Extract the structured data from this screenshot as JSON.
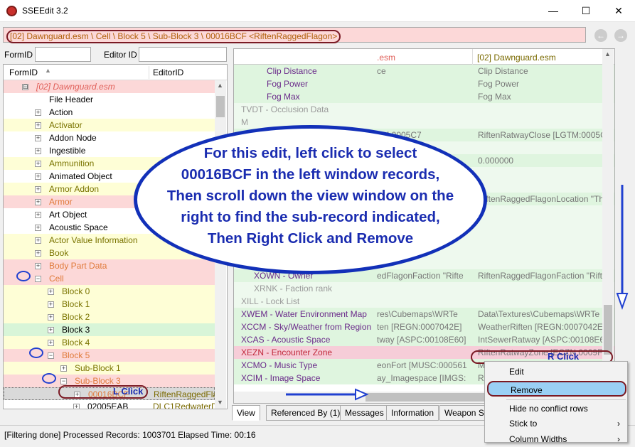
{
  "window": {
    "title": "SSEEdit 3.2",
    "minimize": "—",
    "maximize": "☐",
    "close": "✕"
  },
  "path": {
    "text": "[02] Dawnguard.esm \\ Cell \\ Block 5 \\ Sub-Block 3 \\ 00016BCF <RiftenRaggedFlagon>",
    "back_icon": "back-arrow-icon",
    "forward_icon": "forward-arrow-icon"
  },
  "filters": {
    "formid_label": "FormID",
    "formid_value": "",
    "editorid_label": "Editor ID",
    "editorid_value": ""
  },
  "tree": {
    "col_formid": "FormID",
    "col_editorid": "EditorID",
    "rows": [
      {
        "label": "[02] Dawnguard.esm",
        "editor": "",
        "indent": 0,
        "exp": "⊟",
        "bg": "red",
        "fg": "red",
        "italic": true
      },
      {
        "label": "File Header",
        "editor": "",
        "indent": 1,
        "exp": "",
        "bg": "white",
        "fg": "black"
      },
      {
        "label": "Action",
        "editor": "",
        "indent": 1,
        "exp": "+",
        "bg": "white",
        "fg": "black"
      },
      {
        "label": "Activator",
        "editor": "",
        "indent": 1,
        "exp": "+",
        "bg": "yellow",
        "fg": "olive"
      },
      {
        "label": "Addon Node",
        "editor": "",
        "indent": 1,
        "exp": "+",
        "bg": "white",
        "fg": "black"
      },
      {
        "label": "Ingestible",
        "editor": "",
        "indent": 1,
        "exp": "+",
        "bg": "white",
        "fg": "black"
      },
      {
        "label": "Ammunition",
        "editor": "",
        "indent": 1,
        "exp": "+",
        "bg": "yellow",
        "fg": "olive"
      },
      {
        "label": "Animated Object",
        "editor": "",
        "indent": 1,
        "exp": "+",
        "bg": "white",
        "fg": "black"
      },
      {
        "label": "Armor Addon",
        "editor": "",
        "indent": 1,
        "exp": "+",
        "bg": "yellow",
        "fg": "olive"
      },
      {
        "label": "Armor",
        "editor": "",
        "indent": 1,
        "exp": "+",
        "bg": "red",
        "fg": "orange"
      },
      {
        "label": "Art Object",
        "editor": "",
        "indent": 1,
        "exp": "+",
        "bg": "white",
        "fg": "black"
      },
      {
        "label": "Acoustic Space",
        "editor": "",
        "indent": 1,
        "exp": "+",
        "bg": "white",
        "fg": "black"
      },
      {
        "label": "Actor Value Information",
        "editor": "",
        "indent": 1,
        "exp": "+",
        "bg": "yellow",
        "fg": "olive"
      },
      {
        "label": "Book",
        "editor": "",
        "indent": 1,
        "exp": "+",
        "bg": "yellow",
        "fg": "olive"
      },
      {
        "label": "Body Part Data",
        "editor": "",
        "indent": 1,
        "exp": "+",
        "bg": "red",
        "fg": "orange"
      },
      {
        "label": "Cell",
        "editor": "",
        "indent": 1,
        "exp": "−",
        "bg": "red",
        "fg": "orange"
      },
      {
        "label": "Block 0",
        "editor": "",
        "indent": 2,
        "exp": "+",
        "bg": "yellow",
        "fg": "olive"
      },
      {
        "label": "Block 1",
        "editor": "",
        "indent": 2,
        "exp": "+",
        "bg": "yellow",
        "fg": "olive"
      },
      {
        "label": "Block 2",
        "editor": "",
        "indent": 2,
        "exp": "+",
        "bg": "yellow",
        "fg": "olive"
      },
      {
        "label": "Block 3",
        "editor": "",
        "indent": 2,
        "exp": "+",
        "bg": "green",
        "fg": "black"
      },
      {
        "label": "Block 4",
        "editor": "",
        "indent": 2,
        "exp": "+",
        "bg": "yellow",
        "fg": "olive"
      },
      {
        "label": "Block 5",
        "editor": "",
        "indent": 2,
        "exp": "−",
        "bg": "red",
        "fg": "orange"
      },
      {
        "label": "Sub-Block 1",
        "editor": "",
        "indent": 3,
        "exp": "+",
        "bg": "yellow",
        "fg": "olive"
      },
      {
        "label": "Sub-Block 3",
        "editor": "",
        "indent": 3,
        "exp": "−",
        "bg": "red",
        "fg": "orange"
      },
      {
        "label": "00016BCF",
        "editor": "RiftenRaggedFla",
        "indent": 4,
        "exp": "+",
        "bg": "sel",
        "fg": "orange"
      },
      {
        "label": "02005EAB",
        "editor": "DLC1RedwaterD",
        "indent": 4,
        "exp": "+",
        "bg": "white",
        "fg": "black"
      }
    ]
  },
  "view": {
    "col2_header": ".esm",
    "col3_header": "[02] Dawnguard.esm",
    "rows": [
      {
        "c1": "Clip Distance",
        "c2": "ce",
        "c3": "Clip Distance",
        "cls": "gl",
        "indent": 2,
        "c1cls": "purple"
      },
      {
        "c1": "Fog Power",
        "c2": "",
        "c3": "Fog Power",
        "cls": "gl",
        "indent": 2,
        "c1cls": "purple"
      },
      {
        "c1": "Fog Max",
        "c2": "",
        "c3": "Fog Max",
        "cls": "gl",
        "indent": 2,
        "c1cls": "purple"
      },
      {
        "c1": "TVDT - Occlusion Data",
        "c2": "",
        "c3": "",
        "cls": "gw",
        "indent": 0,
        "c1cls": "gray"
      },
      {
        "c1": "M",
        "c2": "",
        "c3": "",
        "cls": "gw",
        "indent": 0,
        "c1cls": "gray"
      },
      {
        "c1": "",
        "c2": "TM:0005C7",
        "c3": "RiftenRatwayClose [LGTM:0005C7",
        "cls": "gl",
        "indent": 0,
        "c1cls": "purple"
      },
      {
        "c1": "",
        "c2": "",
        "c3": "",
        "cls": "gw",
        "indent": 0,
        "c1cls": "gray"
      },
      {
        "c1": "",
        "c2": "",
        "c3": "0.000000",
        "cls": "gl",
        "indent": 0,
        "c1cls": "purple"
      },
      {
        "c1": "",
        "c2": "",
        "c3": "",
        "cls": "gw",
        "indent": 0,
        "c1cls": "gray"
      },
      {
        "c1": "",
        "c2": "",
        "c3": "",
        "cls": "gw",
        "indent": 0,
        "c1cls": "gray"
      },
      {
        "c1": "",
        "c2": "",
        "c3": "RiftenRaggedFlagonLocation \"Th",
        "cls": "gl",
        "indent": 0,
        "c1cls": "purple"
      },
      {
        "c1": "",
        "c2": "",
        "c3": "",
        "cls": "gw",
        "indent": 0,
        "c1cls": "gray"
      },
      {
        "c1": "",
        "c2": "",
        "c3": "",
        "cls": "gw",
        "indent": 0,
        "c1cls": "gray"
      },
      {
        "c1": "",
        "c2": "",
        "c3": "",
        "cls": "gw",
        "indent": 0,
        "c1cls": "gray"
      },
      {
        "c1": "",
        "c2": "",
        "c3": "",
        "cls": "gw",
        "indent": 0,
        "c1cls": "gray"
      },
      {
        "c1": "Ownership",
        "c2": "",
        "c3": "",
        "cls": "gw",
        "indent": 0,
        "c1cls": "gray"
      },
      {
        "c1": "XOWN - Owner",
        "c2": "edFlagonFaction \"Rifte",
        "c3": "RiftenRaggedFlagonFaction \"Rifte",
        "cls": "gl",
        "indent": 1,
        "c1cls": "purple"
      },
      {
        "c1": "XRNK - Faction rank",
        "c2": "",
        "c3": "",
        "cls": "gw",
        "indent": 1,
        "c1cls": "gray"
      },
      {
        "c1": "XILL - Lock List",
        "c2": "",
        "c3": "",
        "cls": "gw",
        "indent": 0,
        "c1cls": "gray"
      },
      {
        "c1": "XWEM - Water Environment Map",
        "c2": "res\\Cubemaps\\WRTe",
        "c3": "Data\\Textures\\Cubemaps\\WRTe",
        "cls": "gl",
        "indent": 0,
        "c1cls": "purple"
      },
      {
        "c1": "XCCM - Sky/Weather from Region",
        "c2": "ten [REGN:0007042E]",
        "c3": "WeatherRiften [REGN:0007042E]",
        "cls": "gl",
        "indent": 0,
        "c1cls": "purple"
      },
      {
        "c1": "XCAS - Acoustic Space",
        "c2": "tway [ASPC:00108E60]",
        "c3": "IntSewerRatway [ASPC:00108E60]",
        "cls": "gl",
        "indent": 0,
        "c1cls": "purple"
      },
      {
        "c1": "XEZN - Encounter Zone",
        "c2": "",
        "c3": "RiftenRatwayZone [ECZN:0009FB",
        "cls": "pk",
        "indent": 0,
        "c1cls": "red"
      },
      {
        "c1": "XCMO - Music Type",
        "c2": "eonFort [MUSC:000561",
        "c3": "M",
        "cls": "gl",
        "indent": 0,
        "c1cls": "purple"
      },
      {
        "c1": "XCIM - Image Space",
        "c2": "ay_Imagespace [IMGS:",
        "c3": "Ri",
        "cls": "gl",
        "indent": 0,
        "c1cls": "purple"
      }
    ]
  },
  "tabs": [
    "View",
    "Referenced By (1)",
    "Messages",
    "Information",
    "Weapon Sp"
  ],
  "status": "[Filtering done]  Processed Records: 1003701 Elapsed Time: 00:16",
  "context_menu": {
    "items": [
      {
        "label": "Edit",
        "selected": false,
        "submenu": false
      },
      {
        "label": "Remove",
        "selected": true,
        "submenu": false
      },
      {
        "label": "Hide no conflict rows",
        "selected": false,
        "submenu": false
      },
      {
        "label": "Stick to",
        "selected": false,
        "submenu": true
      },
      {
        "label": "Column Widths",
        "selected": false,
        "submenu": true
      }
    ]
  },
  "annotations": {
    "bubble_lines": [
      "For this edit, left click to select",
      "00016BCF in the left window records,",
      "Then scroll down the view window on the",
      "right to find the sub-record indicated,",
      "Then Right Click and Remove"
    ],
    "l_click": "L Click",
    "r_click": "R Click"
  },
  "colors": {
    "annotation_blue": "#1230b8",
    "annotation_dark_red": "#7a1a24",
    "conflict_red_bg": "#fcd8d8",
    "ok_green_bg": "#d8f5d8"
  }
}
